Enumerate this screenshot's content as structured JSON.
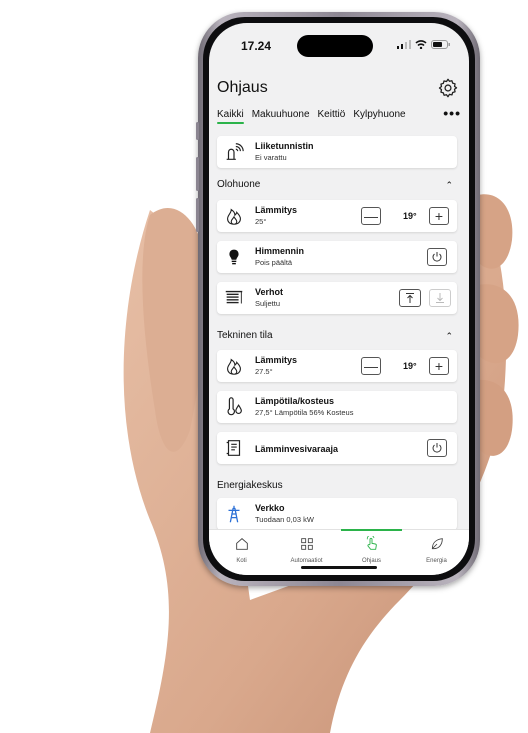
{
  "status": {
    "time": "17.24"
  },
  "header": {
    "title": "Ohjaus",
    "settings_icon": "gear-icon"
  },
  "tabs": [
    {
      "label": "Kaikki",
      "active": true
    },
    {
      "label": "Makuuhuone",
      "active": false
    },
    {
      "label": "Keittiö",
      "active": false
    },
    {
      "label": "Kylpyhuone",
      "active": false
    }
  ],
  "tabs_more": "•••",
  "motion": {
    "name": "Liiketunnistin",
    "status": "Ei varattu",
    "icon": "motion-sensor-icon"
  },
  "olohuone": {
    "title": "Olohuone",
    "heating": {
      "name": "Lämmitys",
      "status": "25°",
      "setpoint": "19°",
      "minus": "—",
      "plus": "+"
    },
    "dimmer": {
      "name": "Himmennin",
      "status": "Pois päältä"
    },
    "curtains": {
      "name": "Verhot",
      "status": "Suljettu"
    }
  },
  "tekninen": {
    "title": "Tekninen tila",
    "heating": {
      "name": "Lämmitys",
      "status": "27.5°",
      "setpoint": "19°",
      "minus": "—",
      "plus": "+"
    },
    "climate": {
      "name": "Lämpötila/kosteus",
      "status": "27,5° Lämpötila 56% Kosteus"
    },
    "boiler": {
      "name": "Lämminvesivaraaja"
    }
  },
  "energia": {
    "title": "Energiakeskus",
    "grid": {
      "name": "Verkko",
      "status": "Tuodaan 0,03 kW"
    }
  },
  "nav": [
    {
      "label": "Koti",
      "icon": "home-icon",
      "active": false
    },
    {
      "label": "Automaatiot",
      "icon": "grid-icon",
      "active": false
    },
    {
      "label": "Ohjaus",
      "icon": "touch-icon",
      "active": true
    },
    {
      "label": "Energia",
      "icon": "leaf-icon",
      "active": false
    }
  ],
  "colors": {
    "accent": "#2bb34a",
    "background": "#f1f1f2",
    "card": "#ffffff"
  }
}
